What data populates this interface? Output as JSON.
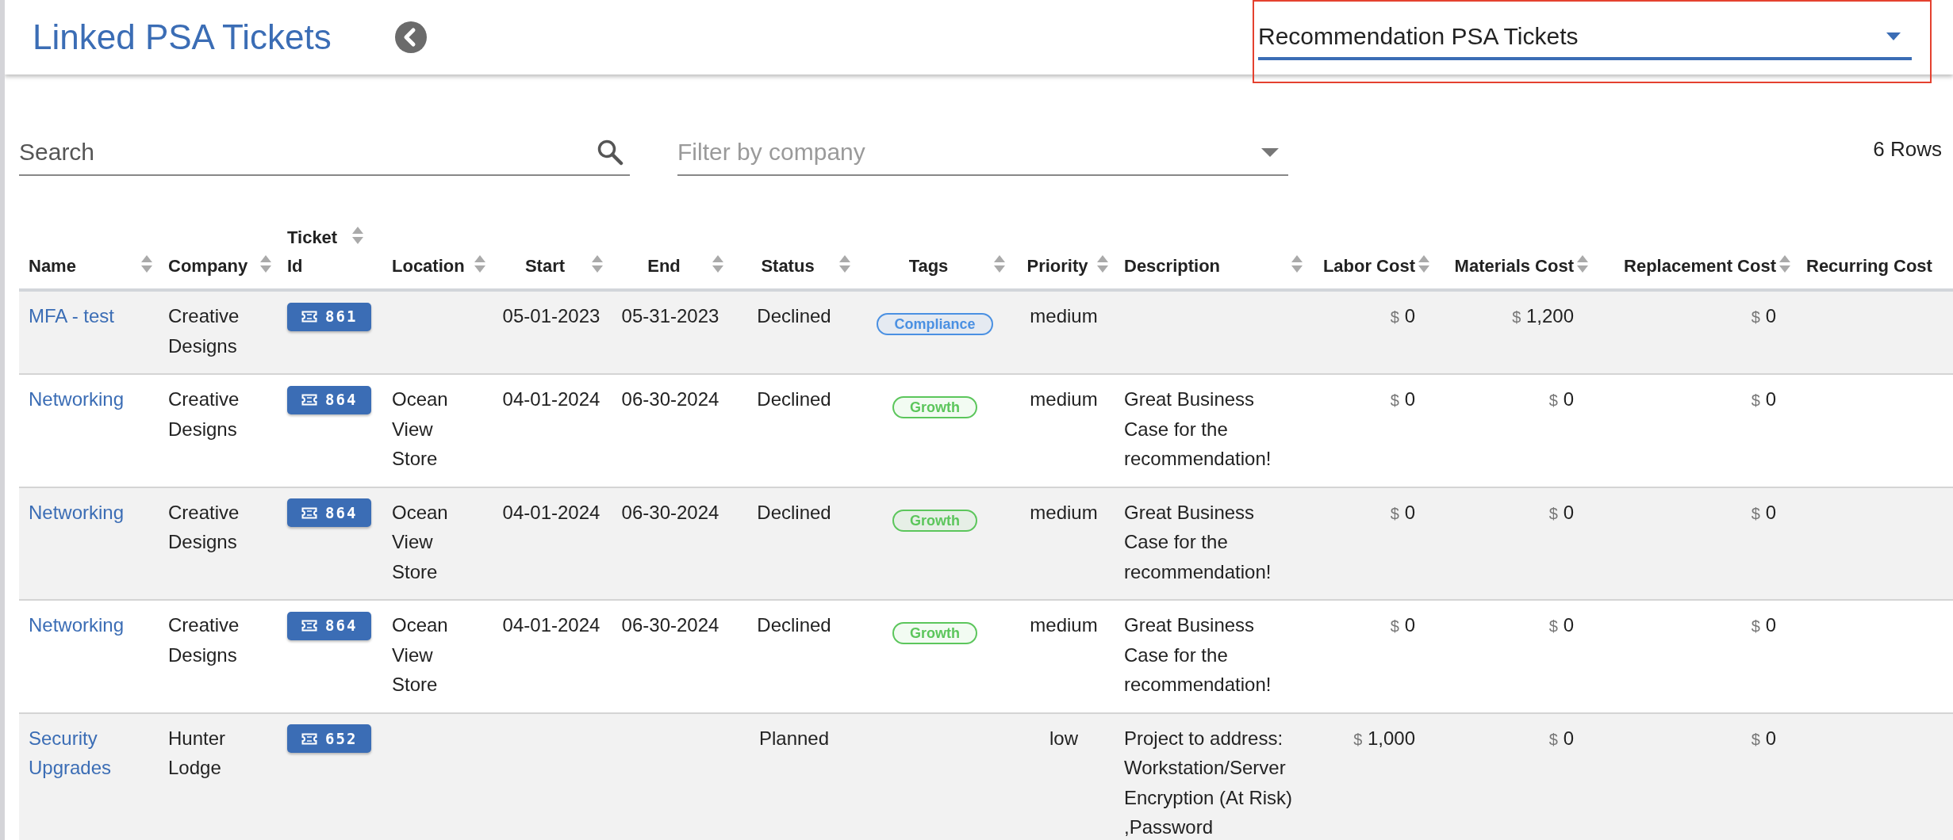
{
  "header": {
    "title": "Linked PSA Tickets",
    "view_select": {
      "value": "Recommendation PSA Tickets"
    }
  },
  "search": {
    "placeholder": "Search"
  },
  "company_filter": {
    "placeholder": "Filter by company"
  },
  "row_count": "6 Rows",
  "table": {
    "columns": [
      "Name",
      "Company",
      "Ticket Id",
      "Location",
      "Start",
      "End",
      "Status",
      "Tags",
      "Priority",
      "Description",
      "Labor Cost",
      "Materials Cost",
      "Replacement Cost",
      "Recurring Cost"
    ],
    "rows": [
      {
        "name": "MFA - test",
        "company": "Creative Designs",
        "ticket": "861",
        "location": "",
        "start": "05-01-2023",
        "end": "05-31-2023",
        "status": "Declined",
        "tags": [
          {
            "label": "Compliance",
            "color": "#4a90e2"
          }
        ],
        "priority": "medium",
        "description": "",
        "labor_cost": {
          "currency": "$",
          "amount": "0"
        },
        "materials_cost": {
          "currency": "$",
          "amount": "1,200"
        },
        "replacement_cost": {
          "currency": "$",
          "amount": "0"
        }
      },
      {
        "name": "Networking",
        "company": "Creative Designs",
        "ticket": "864",
        "location": "Ocean View Store",
        "start": "04-01-2024",
        "end": "06-30-2024",
        "status": "Declined",
        "tags": [
          {
            "label": "Growth",
            "color": "#5cc65c"
          }
        ],
        "priority": "medium",
        "description": "Great Business Case for the recommendation!",
        "labor_cost": {
          "currency": "$",
          "amount": "0"
        },
        "materials_cost": {
          "currency": "$",
          "amount": "0"
        },
        "replacement_cost": {
          "currency": "$",
          "amount": "0"
        }
      },
      {
        "name": "Networking",
        "company": "Creative Designs",
        "ticket": "864",
        "location": "Ocean View Store",
        "start": "04-01-2024",
        "end": "06-30-2024",
        "status": "Declined",
        "tags": [
          {
            "label": "Growth",
            "color": "#5cc65c"
          }
        ],
        "priority": "medium",
        "description": "Great Business Case for the recommendation!",
        "labor_cost": {
          "currency": "$",
          "amount": "0"
        },
        "materials_cost": {
          "currency": "$",
          "amount": "0"
        },
        "replacement_cost": {
          "currency": "$",
          "amount": "0"
        }
      },
      {
        "name": "Networking",
        "company": "Creative Designs",
        "ticket": "864",
        "location": "Ocean View Store",
        "start": "04-01-2024",
        "end": "06-30-2024",
        "status": "Declined",
        "tags": [
          {
            "label": "Growth",
            "color": "#5cc65c"
          }
        ],
        "priority": "medium",
        "description": "Great Business Case for the recommendation!",
        "labor_cost": {
          "currency": "$",
          "amount": "0"
        },
        "materials_cost": {
          "currency": "$",
          "amount": "0"
        },
        "replacement_cost": {
          "currency": "$",
          "amount": "0"
        }
      },
      {
        "name": "Security Upgrades",
        "company": "Hunter Lodge",
        "ticket": "652",
        "location": "",
        "start": "",
        "end": "",
        "status": "Planned",
        "tags": [],
        "priority": "low",
        "description": "Project to address: Workstation/Server Encryption (At Risk) ,Password",
        "labor_cost": {
          "currency": "$",
          "amount": "1,000"
        },
        "materials_cost": {
          "currency": "$",
          "amount": "0"
        },
        "replacement_cost": {
          "currency": "$",
          "amount": "0"
        }
      }
    ]
  }
}
